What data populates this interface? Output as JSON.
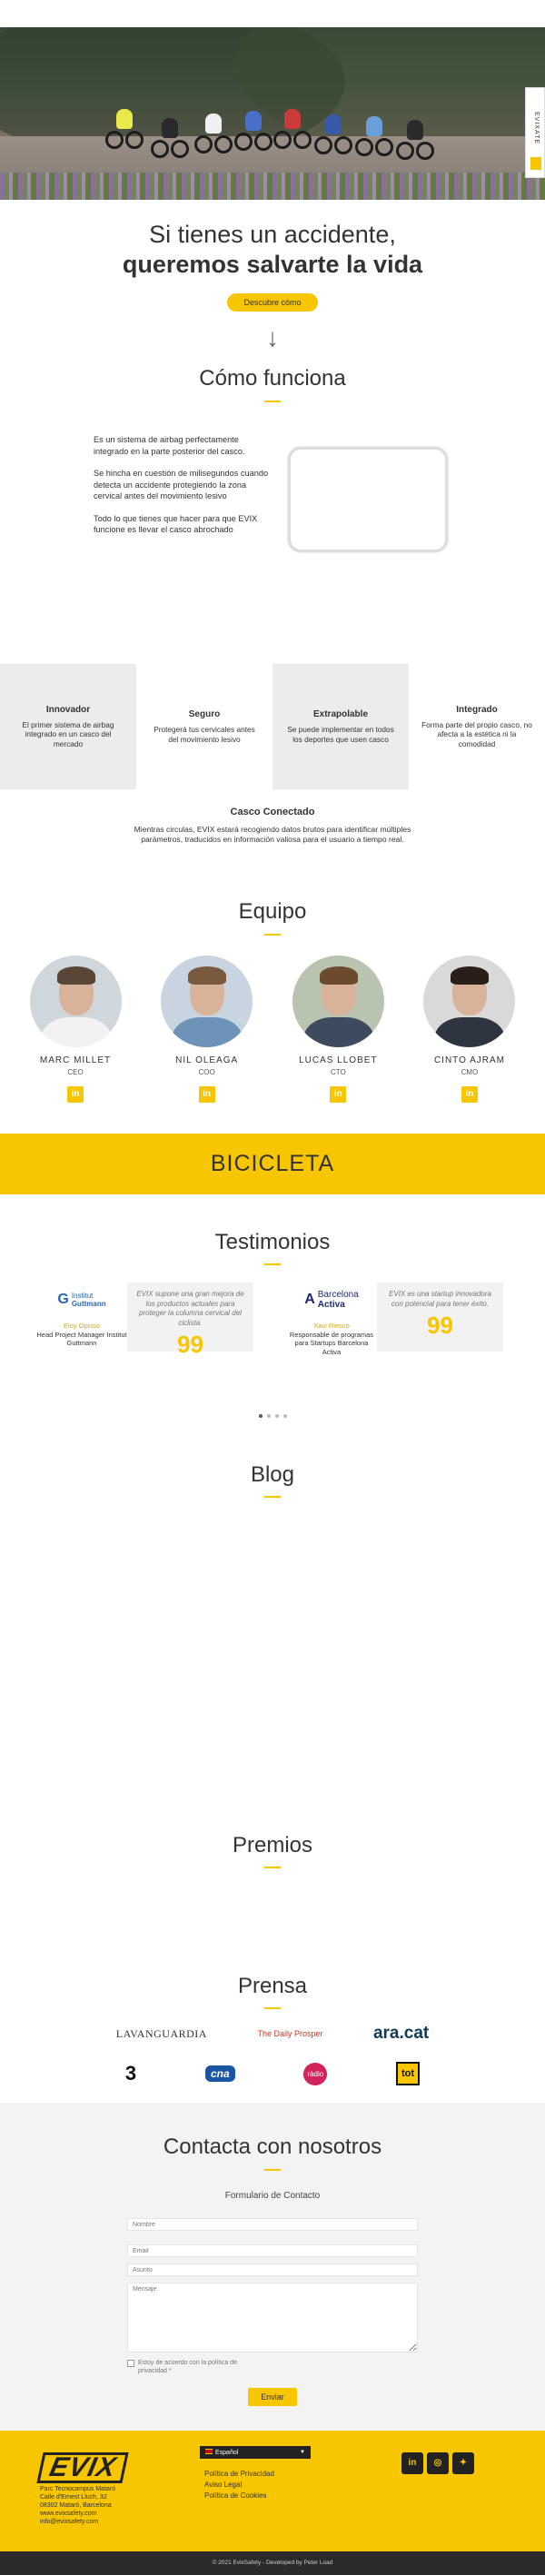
{
  "hero": {
    "side_tab_label": "EVIXATE",
    "slides": 4,
    "title_line1": "Si tienes un accidente,",
    "title_line2": "queremos salvarte la vida",
    "cta_label": "Descubre cómo",
    "arrow": "↓"
  },
  "como": {
    "heading": "Cómo funciona",
    "paragraphs": [
      "Es un sistema de airbag perfectamente integrado en la parte posterior del casco.",
      "Se hincha en cuestión de milisegundos cuando detecta un accidente protegiendo la zona cervical antes del movimiento lesivo",
      "Todo lo que tienes que hacer para que EVIX funcione es llevar el casco abrochado"
    ]
  },
  "features": [
    {
      "title": "Innovador",
      "desc": "El primer sistema de airbag integrado en un casco del mercado"
    },
    {
      "title": "Seguro",
      "desc": "Protegerá tus cervicales antes del movimiento lesivo"
    },
    {
      "title": "Extrapolable",
      "desc": "Se puede implementar en todos los deportes que usen casco"
    },
    {
      "title": "Integrado",
      "desc": "Forma parte del propio casco, no afecta a la estética ni la comodidad"
    }
  ],
  "casco": {
    "title": "Casco Conectado",
    "text": "Mientras circulas, EVIX estará recogiendo datos brutos para identificar múltiples parámetros, traducidos en información valiosa para el usuario a tiempo real."
  },
  "equipo": {
    "heading": "Equipo",
    "linkedin_icon": "in",
    "members": [
      {
        "name": "MARC MILLET",
        "role": "CEO",
        "shirt": "#f2f2f2",
        "bg": "#cfd6dc"
      },
      {
        "name": "NIL OLEAGA",
        "role": "COO",
        "shirt": "#6e93b8",
        "bg": "#c8d4df"
      },
      {
        "name": "LUCAS LLOBET",
        "role": "CTO",
        "shirt": "#3e4a5e",
        "bg": "#b9c4b0"
      },
      {
        "name": "CINTO AJRAM",
        "role": "CMO",
        "shirt": "#2e3440",
        "bg": "#d9d9d9"
      }
    ]
  },
  "bicicleta": {
    "label": "BICICLETA"
  },
  "testimonios": {
    "heading": "Testimonios",
    "items": [
      {
        "logo_line1": "Institut",
        "logo_line2": "Guttmann",
        "name": "Eloy Opisso",
        "role": "Head Project Manager Institut Guttmann",
        "quote": "EVIX supone una gran mejora de los productos actuales para proteger la columna cervical del ciclista."
      },
      {
        "logo_line1": "Barcelona",
        "logo_line2": "Activa",
        "name": "Xavi Riesco",
        "role": "Responsable de programas para Startups Barcelona Activa",
        "quote": "EVIX es una startup innovadora con potencial para tener éxito."
      }
    ],
    "quote_mark": "99",
    "slides": 4
  },
  "blog": {
    "heading": "Blog"
  },
  "premios": {
    "heading": "Premios"
  },
  "prensa": {
    "heading": "Prensa",
    "row1": [
      "LAVANGUARDIA",
      "The Daily Prosper",
      "ara.cat"
    ],
    "row2": [
      "3",
      "cna",
      "ràdio",
      "tot"
    ]
  },
  "contacto": {
    "heading": "Contacta con nosotros",
    "form_title": "Formulario de Contacto",
    "placeholders": {
      "name": "Nombre",
      "email": "Email",
      "subject": "Asunto",
      "message": "Mensaje"
    },
    "privacy": "Estoy de acuerdo con la política de privacidad *",
    "submit": "Enviar"
  },
  "colors": {
    "accent": "#f7c600",
    "dark": "#2b2b2b",
    "light_grey": "#ececec"
  },
  "footer": {
    "logo": "EVIX",
    "address_lines": [
      "Parc Tecnocampus Mataró",
      "Calle d'Ernest Lluch, 32",
      "08302 Mataró, Barcelona",
      "www.evixsafety.com",
      "info@evixsafety.com"
    ],
    "language": "Español",
    "links": [
      "Política de Privacidad",
      "Aviso Legal",
      "Política de Cookies"
    ],
    "copyright": "© 2021 EvixSafety - Developed by Peter Load"
  }
}
